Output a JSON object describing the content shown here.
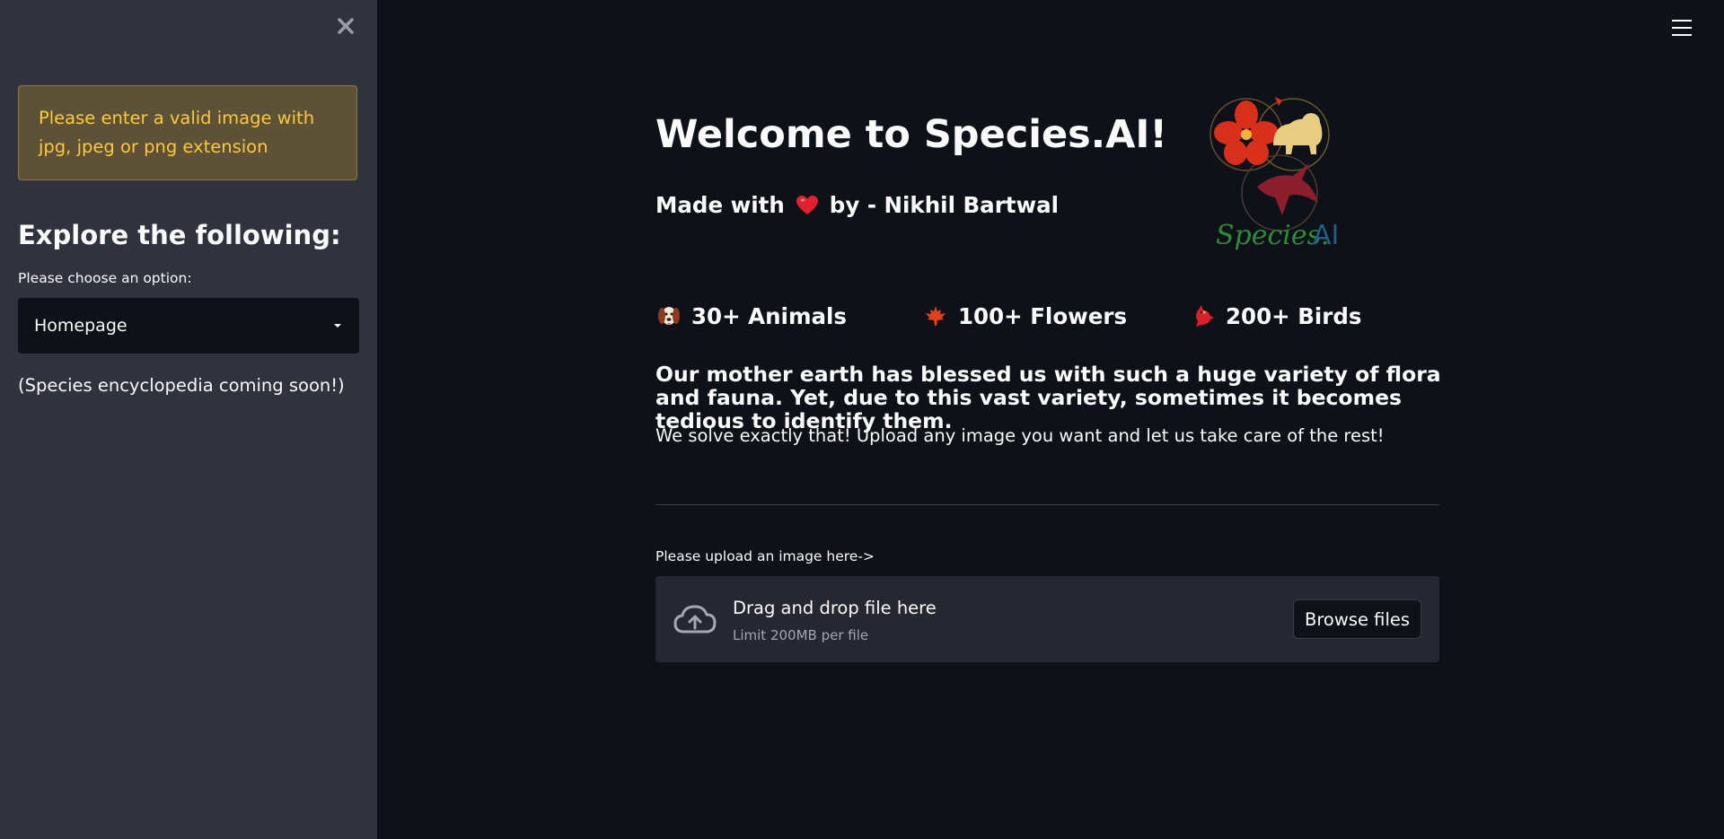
{
  "sidebar": {
    "warning": "Please enter a valid image with jpg, jpeg or png extension",
    "heading": "Explore the following:",
    "select_label": "Please choose an option:",
    "select_value": "Homepage",
    "note": "(Species encyclopedia coming soon!)"
  },
  "main": {
    "title": "Welcome to Species.AI!",
    "made_with_prefix": "Made with",
    "made_with_suffix": "by - Nikhil Bartwal",
    "logo_text_species": "Species.",
    "logo_text_ai": "AI",
    "stats": [
      {
        "icon": "dog-icon",
        "label": "30+ Animals"
      },
      {
        "icon": "maple-leaf-icon",
        "label": "100+ Flowers"
      },
      {
        "icon": "bird-icon",
        "label": "200+ Birds"
      }
    ],
    "intro": "Our mother earth has blessed us with such a huge variety of flora and fauna. Yet, due to this vast variety, sometimes it becomes tedious to identify them.",
    "subtext": "We solve exactly that! Upload any image you want and let us take care of the rest!",
    "upload_label": "Please upload an image here->",
    "dropzone_title": "Drag and drop file here",
    "dropzone_limit": "Limit 200MB per file",
    "browse_label": "Browse files"
  },
  "colors": {
    "background": "#0e1117",
    "sidebar": "#30323e",
    "warning_text": "#ffc83a",
    "heart": "#e0202e"
  }
}
